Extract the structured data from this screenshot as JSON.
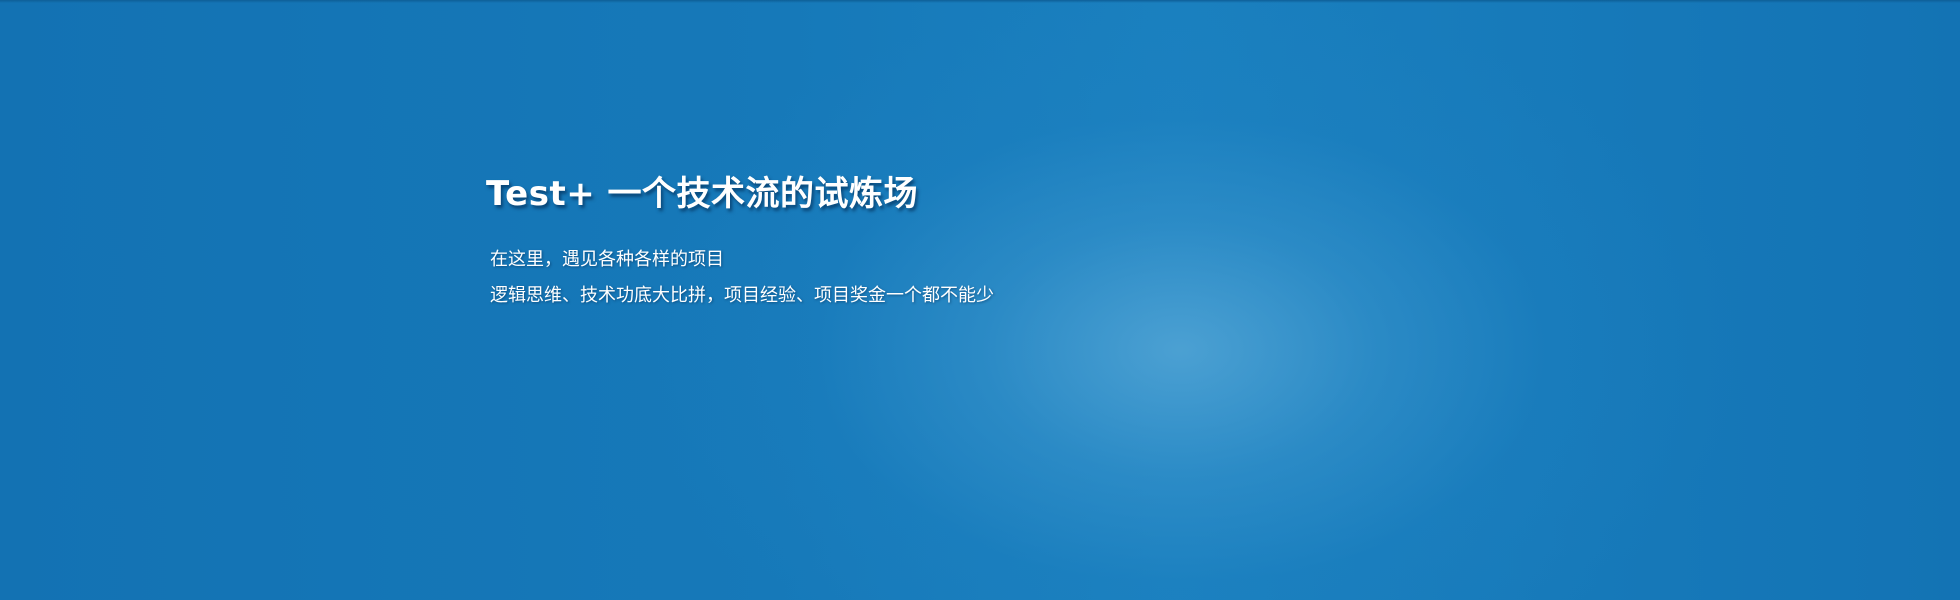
{
  "hero": {
    "title": "Test+ 一个技术流的试炼场",
    "lines": [
      "在这里，遇见各种各样的项目",
      "逻辑思维、技术功底大比拼，项目经验、项目奖金一个都不能少"
    ]
  },
  "colors": {
    "background": "#1378b8",
    "highlight": "#54a6d6",
    "text": "#ffffff"
  }
}
